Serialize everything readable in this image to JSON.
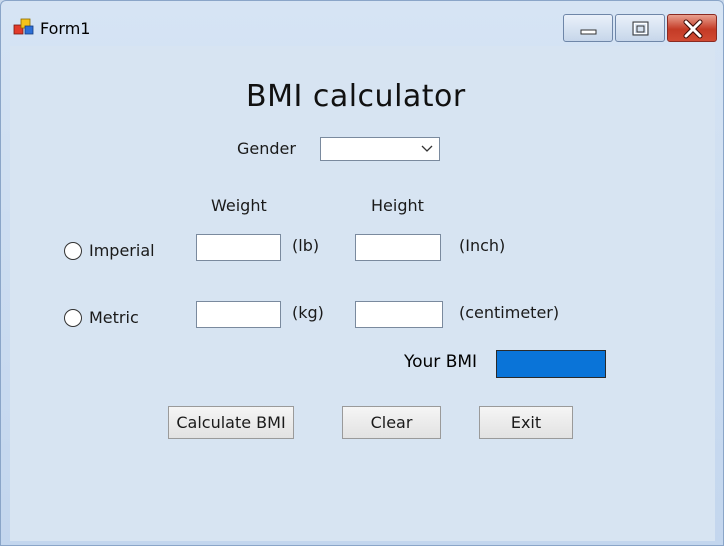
{
  "window": {
    "title": "Form1"
  },
  "form": {
    "heading": "BMI calculator",
    "gender_label": "Gender",
    "gender_value": "",
    "weight_header": "Weight",
    "height_header": "Height",
    "imperial": {
      "label": "Imperial",
      "weight_unit": "(lb)",
      "height_unit": "(Inch)",
      "weight_value": "",
      "height_value": ""
    },
    "metric": {
      "label": "Metric",
      "weight_unit": "(kg)",
      "height_unit": "(centimeter)",
      "weight_value": "",
      "height_value": ""
    },
    "bmi_label": "Your BMI",
    "bmi_value": "",
    "bmi_color": "#0a74d8"
  },
  "buttons": {
    "calculate": "Calculate BMI",
    "clear": "Clear",
    "exit": "Exit"
  }
}
